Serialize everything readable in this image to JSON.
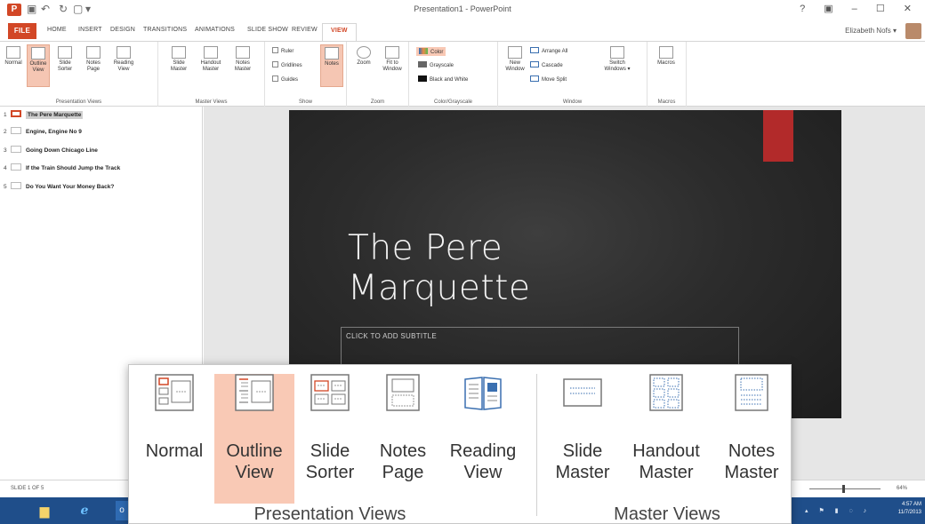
{
  "title_bar": {
    "document_title": "Presentation1 - PowerPoint",
    "controls": "? ▣ – ☐ ✕"
  },
  "tabs": [
    {
      "label": "FILE"
    },
    {
      "label": "HOME"
    },
    {
      "label": "INSERT"
    },
    {
      "label": "DESIGN"
    },
    {
      "label": "TRANSITIONS"
    },
    {
      "label": "ANIMATIONS"
    },
    {
      "label": "SLIDE SHOW"
    },
    {
      "label": "REVIEW"
    },
    {
      "label": "VIEW",
      "active": true
    }
  ],
  "user": {
    "name": "Elizabeth Nofs ▾"
  },
  "ribbon": {
    "presentation_views": {
      "label": "Presentation Views",
      "buttons": [
        "Normal",
        "Outline View",
        "Slide Sorter",
        "Notes Page",
        "Reading View"
      ]
    },
    "master_views": {
      "label": "Master Views",
      "buttons": [
        "Slide Master",
        "Handout Master",
        "Notes Master"
      ]
    },
    "show": {
      "label": "Show",
      "checkboxes": [
        "Ruler",
        "Gridlines",
        "Guides"
      ],
      "notes_button": "Notes"
    },
    "zoom": {
      "label": "Zoom",
      "buttons": [
        "Zoom",
        "Fit to Window"
      ]
    },
    "color_grayscale": {
      "label": "Color/Grayscale",
      "options": [
        "Color",
        "Grayscale",
        "Black and White"
      ]
    },
    "window": {
      "label": "Window",
      "new_window": "New Window",
      "options": [
        "Arrange All",
        "Cascade",
        "Move Split"
      ],
      "switch": "Switch Windows ▾"
    },
    "macros": {
      "label": "Macros",
      "button": "Macros"
    }
  },
  "outline": [
    {
      "num": "1",
      "text": "The Pere Marquette",
      "selected": true
    },
    {
      "num": "2",
      "text": "Engine, Engine No 9"
    },
    {
      "num": "3",
      "text": "Going Down Chicago Line"
    },
    {
      "num": "4",
      "text": "If the Train Should Jump the Track"
    },
    {
      "num": "5",
      "text": "Do You Want Your Money Back?"
    }
  ],
  "slide": {
    "title_line1": "The Pere",
    "title_line2": "Marquette",
    "subtitle_placeholder": "CLICK TO ADD SUBTITLE",
    "accent_color": "#b22a2a"
  },
  "status_bar": {
    "slide_count": "SLIDE 1 OF 5",
    "zoom": "64%"
  },
  "taskbar": {
    "time": "4:57 AM",
    "date": "11/7/2013"
  },
  "callout": {
    "presentation_views": {
      "label": "Presentation Views",
      "buttons": [
        {
          "line1": "Normal",
          "line2": ""
        },
        {
          "line1": "Outline",
          "line2": "View",
          "active": true
        },
        {
          "line1": "Slide",
          "line2": "Sorter"
        },
        {
          "line1": "Notes",
          "line2": "Page"
        },
        {
          "line1": "Reading",
          "line2": "View"
        }
      ]
    },
    "master_views": {
      "label": "Master Views",
      "buttons": [
        {
          "line1": "Slide",
          "line2": "Master"
        },
        {
          "line1": "Handout",
          "line2": "Master"
        },
        {
          "line1": "Notes",
          "line2": "Master"
        }
      ]
    }
  }
}
